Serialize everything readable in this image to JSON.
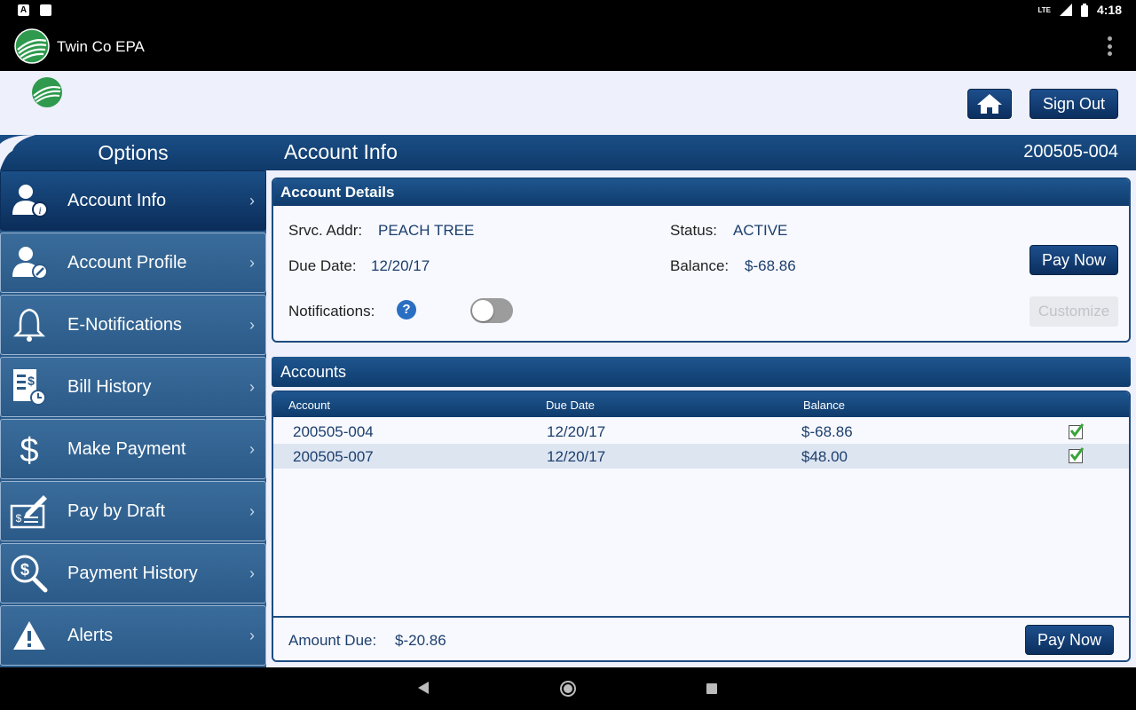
{
  "status_bar": {
    "time": "4:18",
    "net": "LTE"
  },
  "app": {
    "title": "Twin Co EPA"
  },
  "header": {
    "signout_label": "Sign Out"
  },
  "sidebar": {
    "title": "Options",
    "items": [
      {
        "label": "Account Info",
        "icon": "account-info-icon"
      },
      {
        "label": "Account Profile",
        "icon": "account-profile-icon"
      },
      {
        "label": "E-Notifications",
        "icon": "bell-icon"
      },
      {
        "label": "Bill History",
        "icon": "bill-history-icon"
      },
      {
        "label": "Make Payment",
        "icon": "dollar-icon"
      },
      {
        "label": "Pay by Draft",
        "icon": "check-draft-icon"
      },
      {
        "label": "Payment History",
        "icon": "payment-history-icon"
      },
      {
        "label": "Alerts",
        "icon": "warning-icon"
      }
    ],
    "arrow": "›"
  },
  "main": {
    "title": "Account Info",
    "account_number": "200505-004",
    "details": {
      "title": "Account Details",
      "srvc_addr_label": "Srvc. Addr:",
      "srvc_addr": "PEACH TREE",
      "status_label": "Status:",
      "status": "ACTIVE",
      "due_date_label": "Due Date:",
      "due_date": "12/20/17",
      "balance_label": "Balance:",
      "balance": "$-68.86",
      "notifications_label": "Notifications:",
      "help_glyph": "?",
      "pay_now_label": "Pay Now",
      "customize_label": "Customize"
    },
    "accounts": {
      "title": "Accounts",
      "columns": [
        "Account",
        "Due Date",
        "Balance"
      ],
      "rows": [
        {
          "account": "200505-004",
          "due_date": "12/20/17",
          "balance": "$-68.86",
          "checked": true
        },
        {
          "account": "200505-007",
          "due_date": "12/20/17",
          "balance": "$48.00",
          "checked": true
        }
      ],
      "amount_due_label": "Amount Due:",
      "amount_due": "$-20.86",
      "pay_now_label": "Pay Now"
    }
  },
  "colors": {
    "brand_dark": "#0b2f5e",
    "sidebar": "#2a5b8a",
    "panel_bg": "#eef0fb",
    "check_green": "#3aa43a"
  }
}
